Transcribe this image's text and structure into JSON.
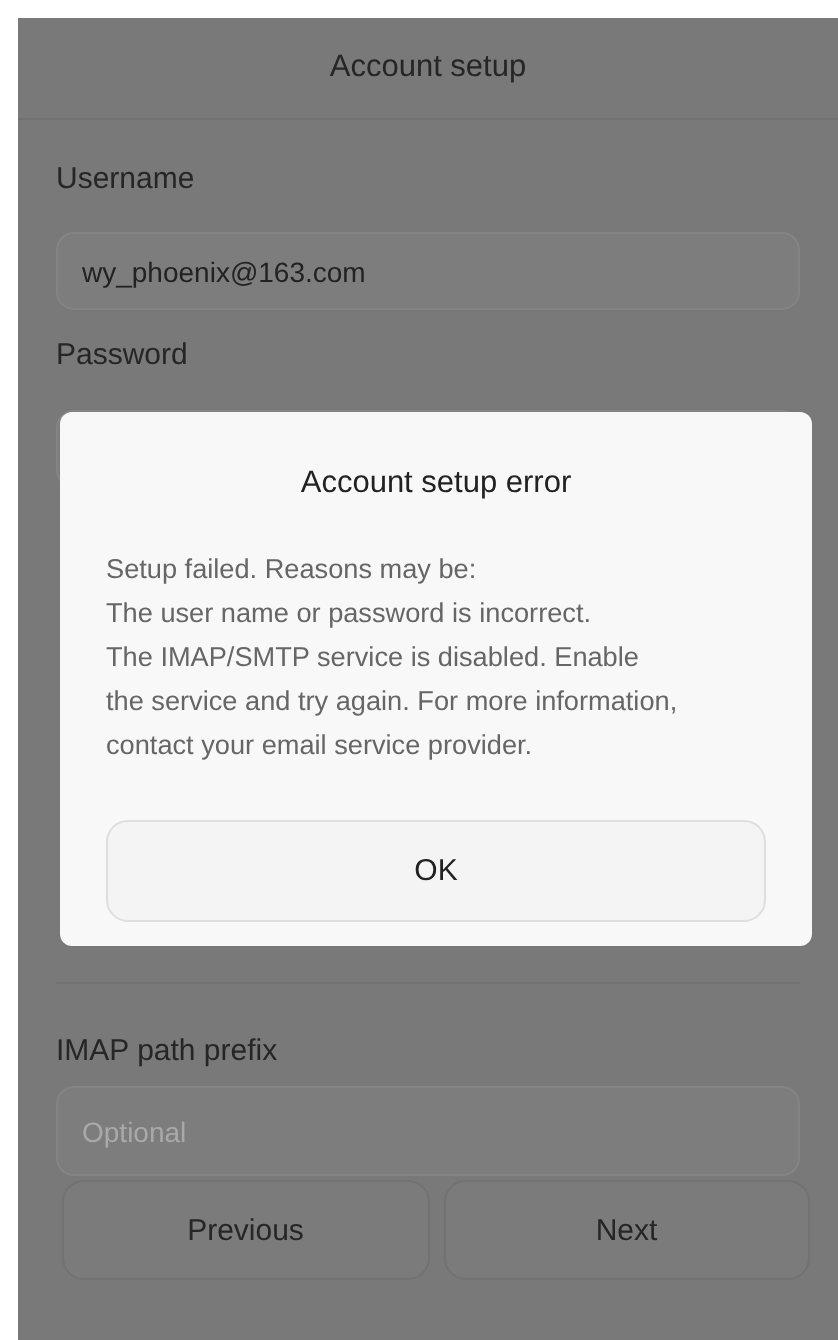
{
  "header": {
    "title": "Account setup"
  },
  "fields": [
    {
      "label": "Username",
      "value": "wy_phoenix@163.com"
    },
    {
      "label": "Password"
    }
  ],
  "extra_fields": [
    {
      "label": "IMAP path prefix",
      "placeholder": "Optional"
    }
  ],
  "buttons": [
    {
      "label": "Previous"
    },
    {
      "label": "Next"
    }
  ],
  "dialog": {
    "title": "Account setup error",
    "message": "Setup failed. Reasons may be:\nThe user name or password is incorrect.\nThe IMAP/SMTP service is disabled. Enable\nthe service and try again. For more information,\ncontact your email service provider.",
    "button": "OK"
  }
}
